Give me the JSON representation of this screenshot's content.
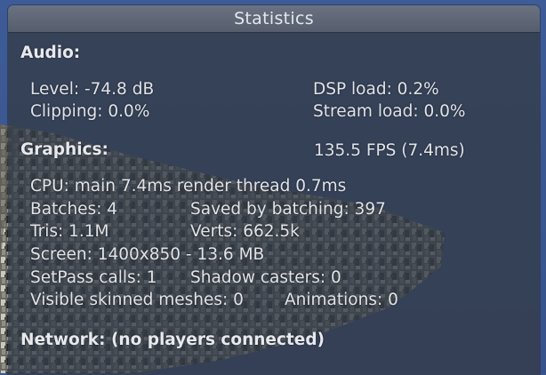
{
  "window": {
    "title": "Statistics"
  },
  "audio": {
    "header": "Audio:",
    "level": "Level: -74.8 dB",
    "dsp_load": "DSP load: 0.2%",
    "clipping": "Clipping: 0.0%",
    "stream_load": "Stream load: 0.0%"
  },
  "graphics": {
    "header": "Graphics:",
    "fps": "135.5 FPS (7.4ms)",
    "cpu": "CPU: main 7.4ms  render thread 0.7ms",
    "batches": "Batches: 4",
    "saved_by_batching": "Saved by batching: 397",
    "tris": "Tris: 1.1M",
    "verts": "Verts: 662.5k",
    "screen": "Screen: 1400x850 - 13.6 MB",
    "setpass_calls": "SetPass calls: 1",
    "shadow_casters": "Shadow casters: 0",
    "visible_skinned_meshes": "Visible skinned meshes: 0",
    "animations": "Animations: 0"
  },
  "network": {
    "status": "Network: (no players connected)"
  },
  "colors": {
    "sky": "#3a5690",
    "panel": "#343c48",
    "title_bar": "#606877",
    "text": "#e0e3e8"
  }
}
